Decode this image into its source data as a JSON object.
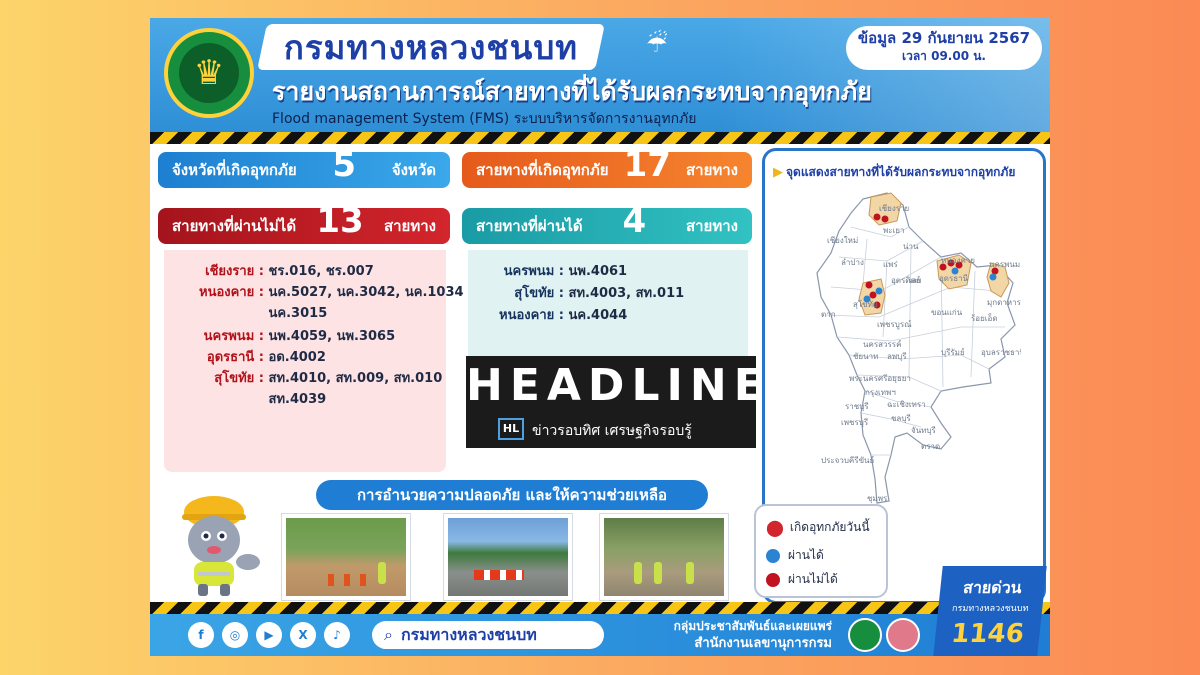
{
  "header": {
    "department": "กรมทางหลวงชนบท",
    "report_title": "รายงานสถานการณ์สายทางที่ได้รับผลกระทบจากอุทกภัย",
    "subtitle": "Flood management System (FMS) ระบบบริหารจัดการงานอุทกภัย",
    "date": "ข้อมูล 29 กันยายน 2567",
    "time": "เวลา 09.00 น.",
    "logo_icon": "department-emblem-icon",
    "rain_icon": "cloud-rain-icon"
  },
  "stats": {
    "provinces": {
      "label": "จังหวัดที่เกิดอุทกภัย",
      "value": "5",
      "unit": "จังหวัด",
      "color": "#1e7fd0"
    },
    "affected": {
      "label": "สายทางที่เกิดอุทกภัย",
      "value": "17",
      "unit": "สายทาง",
      "color": "#e55a1c"
    },
    "blocked": {
      "label": "สายทางที่ผ่านไม่ได้",
      "value": "13",
      "unit": "สายทาง",
      "color": "#b2121a"
    },
    "passable": {
      "label": "สายทางที่ผ่านได้",
      "value": "4",
      "unit": "สายทาง",
      "color": "#1a9ba5"
    }
  },
  "blocked_routes": [
    {
      "province": "เชียงราย :",
      "routes": "ชร.016, ชร.007"
    },
    {
      "province": "หนองคาย :",
      "routes": "นค.5027, นค.3042, นค.1034"
    },
    {
      "province": "",
      "routes": "นค.3015"
    },
    {
      "province": "นครพนม :",
      "routes": "นพ.4059, นพ.3065"
    },
    {
      "province": "อุดรธานี :",
      "routes": "อด.4002"
    },
    {
      "province": "สุโขทัย :",
      "routes": "สท.4010, สท.009, สท.010"
    },
    {
      "province": "",
      "routes": "สท.4039"
    }
  ],
  "passable_routes": [
    {
      "province": "นครพนม :",
      "routes": "นพ.4061"
    },
    {
      "province": "สุโขทัย :",
      "routes": "สท.4003, สท.011"
    },
    {
      "province": "หนองคาย :",
      "routes": "นค.4044"
    }
  ],
  "watermark": {
    "word": "HEADLINE",
    "badge": "HL",
    "tagline": "ข่าวรอบทิศ เศรษฐกิจรอบรู้"
  },
  "map": {
    "title": "จุดแสดงสายทางที่ได้รับผลกระทบจากอุทกภัย",
    "labels": {
      "chiangrai": "เชียงราย",
      "phayao": "พะเยา",
      "chiangmai": "เชียงใหม่",
      "nan": "น่าน",
      "lampang": "ลำปาง",
      "phrae": "แพร่",
      "sukhothai": "สุโขทัย",
      "uttaradit": "อุตรดิตถ์",
      "nongkhai": "หนองคาย",
      "udon": "อุดรธานี",
      "nakhonphanom": "นครพนม",
      "loei": "เลย",
      "tak": "ตาก",
      "mukdahan": "มุกดาหาร",
      "phetchabun": "เพชรบูรณ์",
      "khonkaen": "ขอนแก่น",
      "roiet": "ร้อยเอ็ด",
      "nakhonsawan": "นครสวรรค์",
      "chainat": "ชัยนาท",
      "lopburi": "ลพบุรี",
      "buriram": "บุรีรัมย์",
      "ubon": "อุบลราชธานี",
      "ayutthaya": "พระนครศรีอยุธยา",
      "bangkok": "กรุงเทพฯ",
      "chachoengsao": "ฉะเชิงเทรา",
      "ratchaburi": "ราชบุรี",
      "chonburi": "ชลบุรี",
      "phetchaburi": "เพชรบุรี",
      "chanthaburi": "จันทบุรี",
      "trat": "ตราด",
      "prachuap": "ประจวบคีรีขันธ์",
      "chumphon": "ชุมพร"
    }
  },
  "legend": {
    "new_flood": "เกิดอุทกภัยวันนี้",
    "passable": "ผ่านได้",
    "blocked": "ผ่านไม่ได้",
    "pin_color": "#d1262d",
    "pass_color": "#2a84d2",
    "block_color": "#c1121f"
  },
  "safety": {
    "banner": "การอำนวยความปลอดภัย และให้ความช่วยเหลือ"
  },
  "hotline": {
    "label": "สายด่วน",
    "org": "กรมทางหลวงชนบท",
    "number": "1146"
  },
  "footer": {
    "social": [
      {
        "icon": "facebook-icon",
        "glyph": "f"
      },
      {
        "icon": "instagram-icon",
        "glyph": "◎"
      },
      {
        "icon": "youtube-icon",
        "glyph": "▶"
      },
      {
        "icon": "x-icon",
        "glyph": "X"
      },
      {
        "icon": "tiktok-icon",
        "glyph": "♪"
      }
    ],
    "search_text": "กรมทางหลวงชนบท",
    "org_line1": "กลุ่มประชาสัมพันธ์และเผยแพร่",
    "org_line2": "สำนักงานเลขานุการกรม"
  }
}
